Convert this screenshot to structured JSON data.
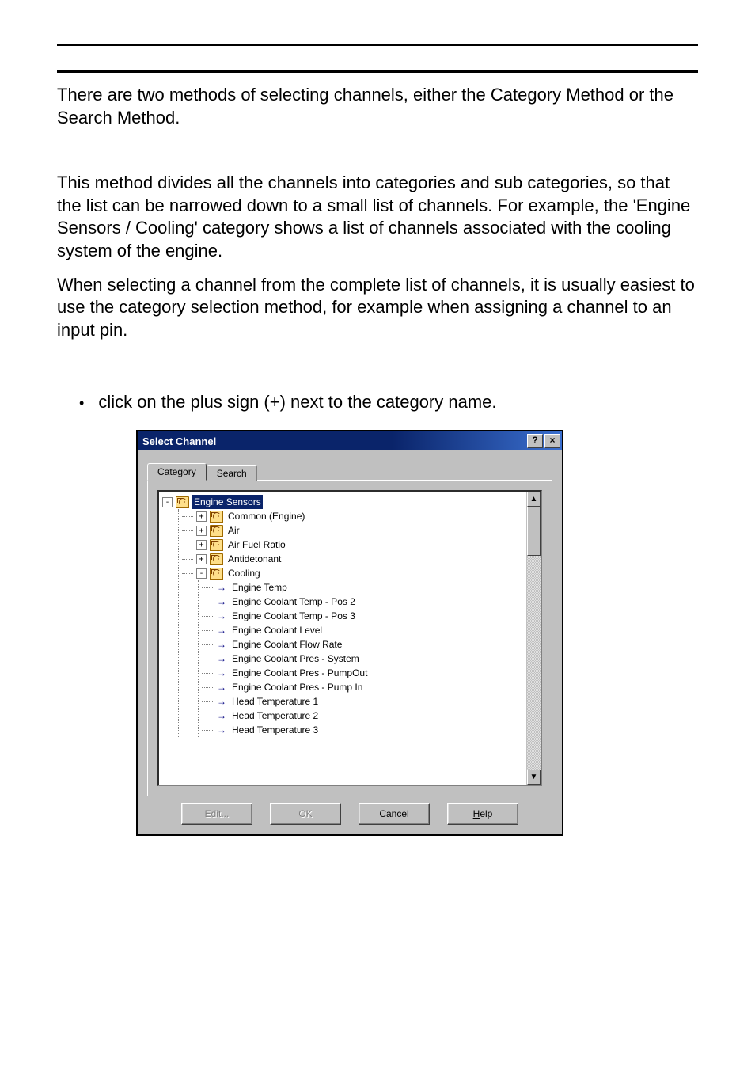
{
  "doc": {
    "p1": "There are two methods of selecting channels, either the Category Method or the Search Method.",
    "p2": "This method divides all the channels into categories and sub categories, so that the list can be narrowed down to a small list of channels. For example, the 'Engine Sensors / Cooling' category shows a list of channels associated with the cooling system of the engine.",
    "p3": "When selecting a channel from the complete list of channels, it is usually easiest to use the category selection method, for example when assigning a channel to an input pin.",
    "bullet1": "click on the plus sign (+) next to the category name."
  },
  "dialog": {
    "title": "Select Channel",
    "tabs": {
      "category": "Category",
      "search": "Search",
      "active": "Category"
    },
    "buttons": {
      "edit": "Edit...",
      "ok": "OK",
      "cancel": "Cancel",
      "help_pre": "H",
      "help_rest": "elp"
    },
    "tree": {
      "root": {
        "label": "Engine Sensors",
        "state": "expanded",
        "selected": true
      },
      "children": [
        {
          "label": "Common (Engine)",
          "state": "collapsed"
        },
        {
          "label": "Air",
          "state": "collapsed"
        },
        {
          "label": "Air Fuel Ratio",
          "state": "collapsed"
        },
        {
          "label": "Antidetonant",
          "state": "collapsed"
        },
        {
          "label": "Cooling",
          "state": "expanded",
          "items": [
            "Engine Temp",
            "Engine Coolant Temp - Pos 2",
            "Engine Coolant Temp - Pos 3",
            "Engine Coolant Level",
            "Engine Coolant Flow Rate",
            "Engine Coolant Pres - System",
            "Engine Coolant Pres - PumpOut",
            "Engine Coolant Pres - Pump In",
            "Head Temperature 1",
            "Head Temperature 2",
            "Head Temperature 3"
          ]
        }
      ]
    }
  }
}
